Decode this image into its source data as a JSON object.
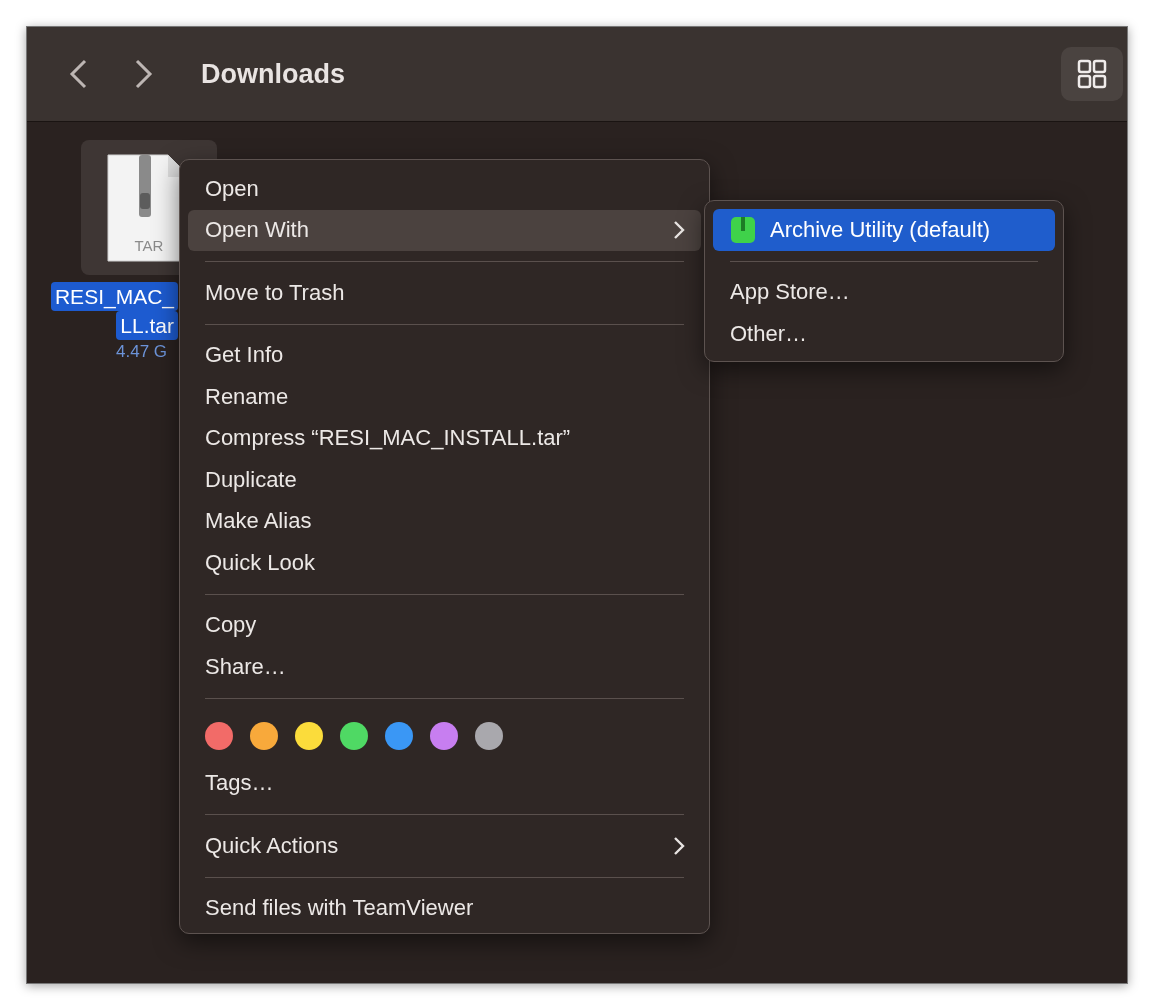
{
  "window": {
    "title": "Downloads"
  },
  "file": {
    "label_lines": [
      "RESI_MAC_",
      "LL.tar"
    ],
    "size": "4.47 G",
    "type_label": "TAR",
    "selected": true
  },
  "context_menu": {
    "items": [
      {
        "kind": "item",
        "label": "Open",
        "selected": false,
        "submenu": false
      },
      {
        "kind": "item",
        "label": "Open With",
        "selected": true,
        "submenu": true
      },
      {
        "kind": "separator"
      },
      {
        "kind": "item",
        "label": "Move to Trash",
        "selected": false,
        "submenu": false
      },
      {
        "kind": "separator"
      },
      {
        "kind": "item",
        "label": "Get Info",
        "selected": false,
        "submenu": false
      },
      {
        "kind": "item",
        "label": "Rename",
        "selected": false,
        "submenu": false
      },
      {
        "kind": "item",
        "label": "Compress “RESI_MAC_INSTALL.tar”",
        "selected": false,
        "submenu": false
      },
      {
        "kind": "item",
        "label": "Duplicate",
        "selected": false,
        "submenu": false
      },
      {
        "kind": "item",
        "label": "Make Alias",
        "selected": false,
        "submenu": false
      },
      {
        "kind": "item",
        "label": "Quick Look",
        "selected": false,
        "submenu": false
      },
      {
        "kind": "separator"
      },
      {
        "kind": "item",
        "label": "Copy",
        "selected": false,
        "submenu": false
      },
      {
        "kind": "item",
        "label": "Share…",
        "selected": false,
        "submenu": false
      },
      {
        "kind": "separator"
      },
      {
        "kind": "tags",
        "dots": [
          {
            "color": "#f26b68"
          },
          {
            "color": "#f8a93b"
          },
          {
            "color": "#fbdc3b"
          },
          {
            "color": "#4fd964"
          },
          {
            "color": "#3a97f5"
          },
          {
            "color": "#c77ef0"
          },
          {
            "color": "#a9a8ad"
          }
        ]
      },
      {
        "kind": "item",
        "label": "Tags…",
        "selected": false,
        "submenu": false
      },
      {
        "kind": "separator"
      },
      {
        "kind": "item",
        "label": "Quick Actions",
        "selected": false,
        "submenu": true
      },
      {
        "kind": "separator"
      },
      {
        "kind": "item",
        "label": "Send files with TeamViewer",
        "selected": false,
        "submenu": false
      }
    ]
  },
  "submenu": {
    "items": [
      {
        "kind": "app",
        "label": "Archive Utility (default)",
        "selected": true
      },
      {
        "kind": "separator"
      },
      {
        "kind": "item",
        "label": "App Store…",
        "selected": false
      },
      {
        "kind": "item",
        "label": "Other…",
        "selected": false
      }
    ]
  }
}
